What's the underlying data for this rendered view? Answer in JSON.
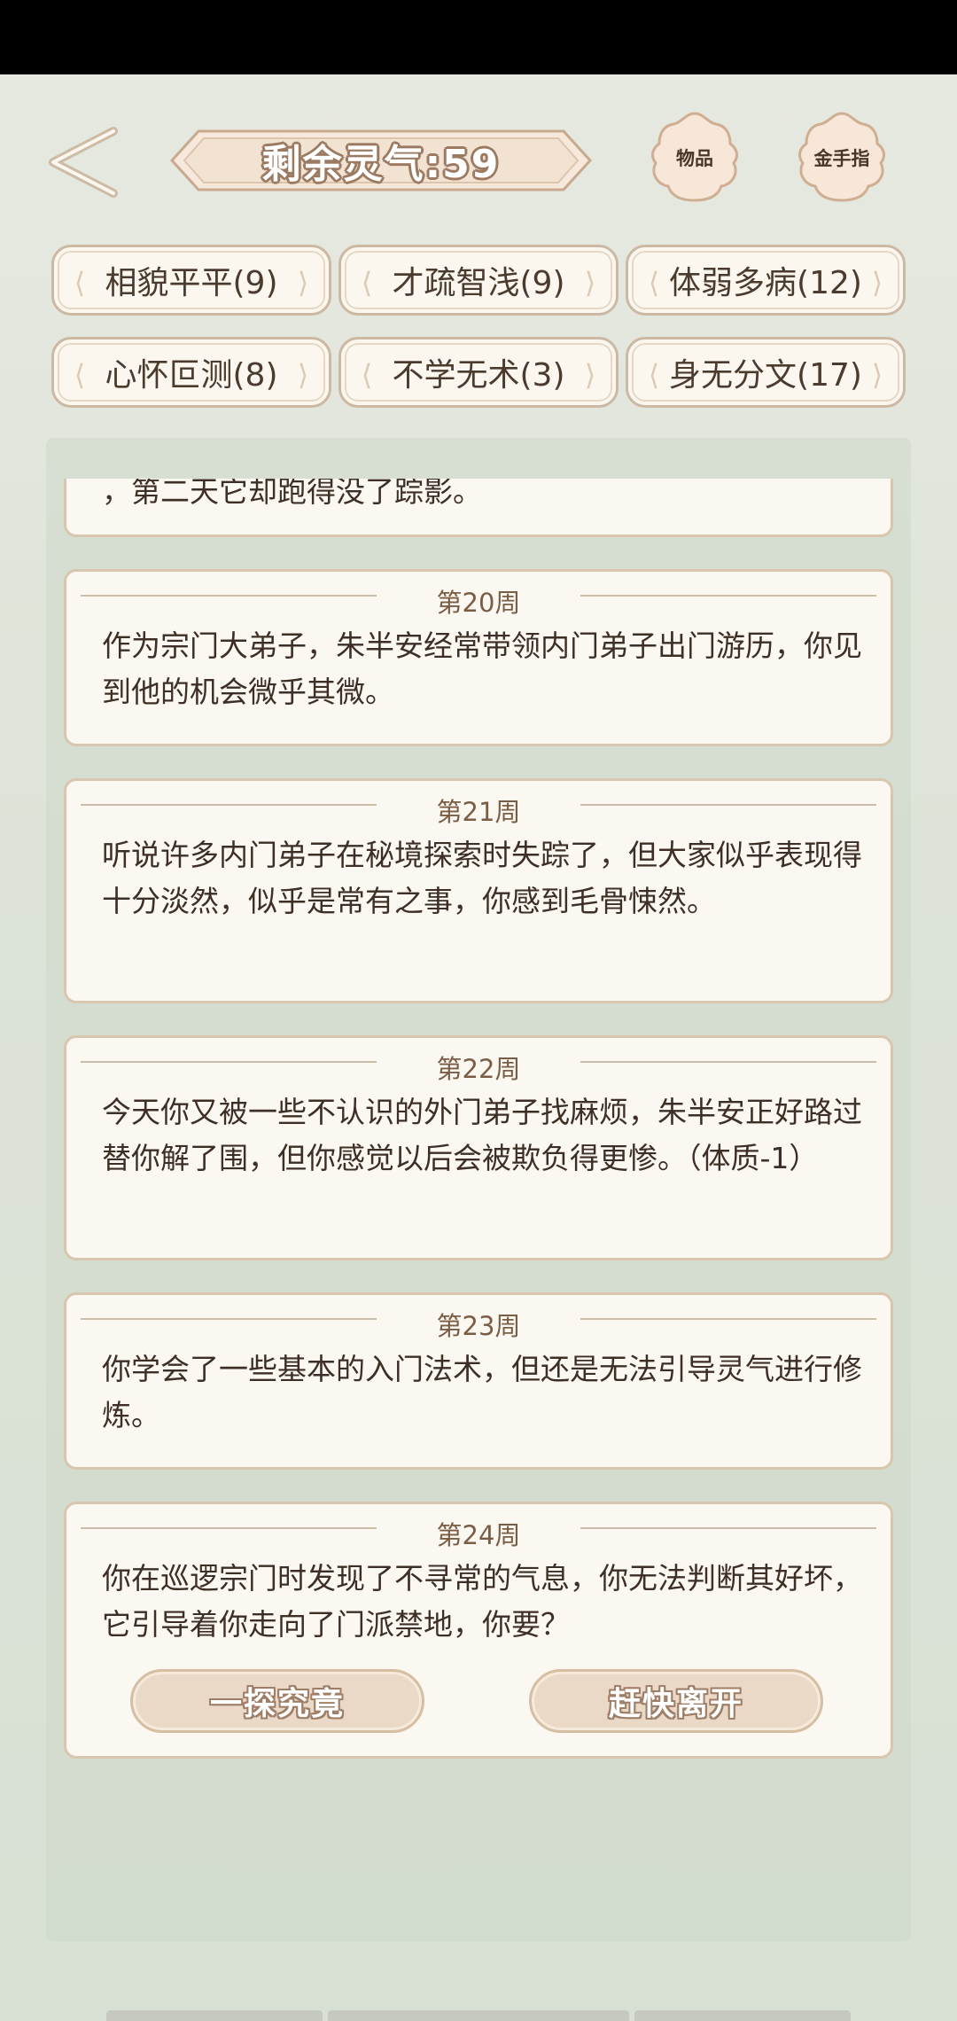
{
  "header": {
    "spirit_label": "剩余灵气:59",
    "items_button": "物品",
    "cheat_button": "金手指"
  },
  "traits": [
    {
      "label": "相貌平平(9)"
    },
    {
      "label": "才疏智浅(9)"
    },
    {
      "label": "体弱多病(12)"
    },
    {
      "label": "心怀叵测(8)"
    },
    {
      "label": "不学无术(3)"
    },
    {
      "label": "身无分文(17)"
    }
  ],
  "log": {
    "partial_text": "，第二天它却跑得没了踪影。",
    "entries": [
      {
        "week": "第20周",
        "text": "作为宗门大弟子，朱半安经常带领内门弟子出门游历，你见到他的机会微乎其微。"
      },
      {
        "week": "第21周",
        "text": "听说许多内门弟子在秘境探索时失踪了，但大家似乎表现得十分淡然，似乎是常有之事，你感到毛骨悚然。"
      },
      {
        "week": "第22周",
        "text": "今天你又被一些不认识的外门弟子找麻烦，朱半安正好路过替你解了围，但你感觉以后会被欺负得更惨。（体质-1）"
      },
      {
        "week": "第23周",
        "text": "你学会了一些基本的入门法术，但还是无法引导灵气进行修炼。"
      },
      {
        "week": "第24周",
        "text": "你在巡逻宗门时发现了不寻常的气息，你无法判断其好坏，它引导着你走向了门派禁地，你要？"
      }
    ],
    "choices": {
      "explore": "一探究竟",
      "leave": "赶快离开"
    }
  }
}
